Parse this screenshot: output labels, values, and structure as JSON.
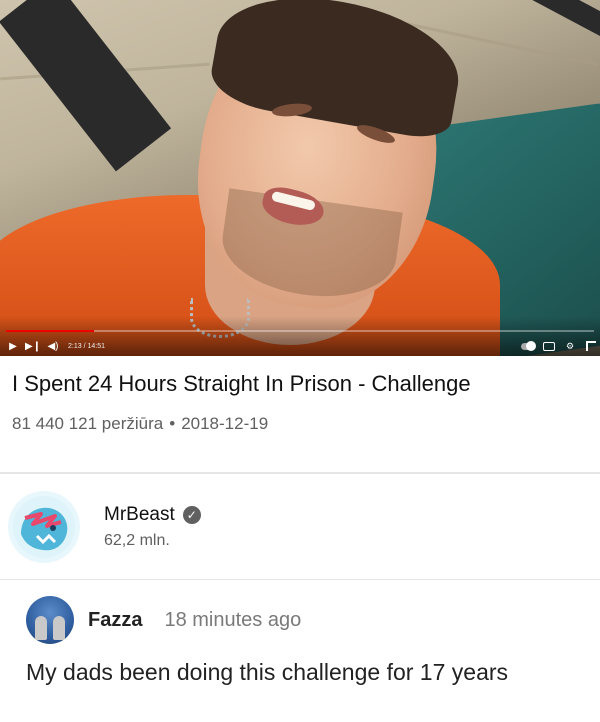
{
  "video": {
    "player": {
      "time_display": "2:13 / 14:51",
      "progress_fraction": 0.149,
      "accent_color": "#ee0000",
      "controls": {
        "play": "play-icon",
        "next": "next-icon",
        "volume": "volume-icon",
        "autoplay": "autoplay-toggle",
        "captions": "captions-icon",
        "settings": "gear-icon",
        "fullscreen": "fullscreen-icon"
      }
    },
    "title": "I Spent 24 Hours Straight In Prison - Challenge",
    "views": "81 440 121 peržiūra",
    "separator": "•",
    "date": "2018-12-19"
  },
  "channel": {
    "name": "MrBeast",
    "subscribers": "62,2 mln.",
    "verified_icon": "check-icon"
  },
  "comment": {
    "author": "Fazza",
    "time": "18 minutes ago",
    "text": "My dads been doing this challenge for 17 years"
  }
}
